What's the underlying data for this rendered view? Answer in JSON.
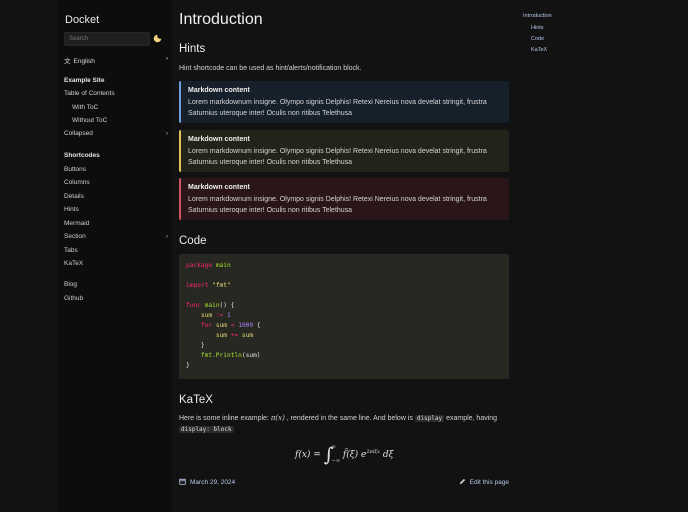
{
  "sidebar": {
    "title": "Docket",
    "search_placeholder": "Search",
    "language": "English",
    "items": [
      {
        "label": "Example Site",
        "bold": true
      },
      {
        "label": "Table of Contents"
      },
      {
        "label": "With ToC",
        "sub": true
      },
      {
        "label": "Without ToC",
        "sub": true
      },
      {
        "label": "Collapsed",
        "chevron": true
      },
      {
        "label": "Shortcodes",
        "bold": true
      },
      {
        "label": "Buttons"
      },
      {
        "label": "Columns"
      },
      {
        "label": "Details"
      },
      {
        "label": "Hints"
      },
      {
        "label": "Mermaid"
      },
      {
        "label": "Section",
        "chevron": true
      },
      {
        "label": "Tabs"
      },
      {
        "label": "KaTeX"
      },
      {
        "label": "Blog"
      },
      {
        "label": "Github"
      }
    ]
  },
  "main": {
    "title": "Introduction",
    "hints_heading": "Hints",
    "hints_intro": "Hint shortcode can be used as hint/alerts/notification block.",
    "hints": [
      {
        "title": "Markdown content",
        "body": "Lorem markdownum insigne. Olympo signis Delphis! Retexi Nereius nova develat stringit, frustra Saturnius uteroque inter! Oculis non ritibus Telethusa",
        "kind": "info"
      },
      {
        "title": "Markdown content",
        "body": "Lorem markdownum insigne. Olympo signis Delphis! Retexi Nereius nova develat stringit, frustra Saturnius uteroque inter! Oculis non ritibus Telethusa",
        "kind": "warn"
      },
      {
        "title": "Markdown content",
        "body": "Lorem markdownum insigne. Olympo signis Delphis! Retexi Nereius nova develat stringit, frustra Saturnius uteroque inter! Oculis non ritibus Telethusa",
        "kind": "danger"
      }
    ],
    "code_heading": "Code",
    "code": {
      "line1_kw": "package",
      "line1_nm": "main",
      "line2_kw": "import",
      "line2_st": "\"fmt\"",
      "line3_kw": "func",
      "line3_nm": "main",
      "line3_rest": "() {",
      "line4_var": "sum",
      "line4_op": ":=",
      "line4_num": "1",
      "line5_kw": "for",
      "line5_var": "sum",
      "line5_op": "<",
      "line5_num": "1000",
      "line5_rest": "{",
      "line6_var": "sum",
      "line6_op": "+=",
      "line6_var2": "sum",
      "line7": "}",
      "line8_nm": "fmt.Println",
      "line8_arg": "(sum)",
      "line9": "}"
    },
    "katex_heading": "KaTeX",
    "katex_text_1": "Here is some inline example:",
    "katex_inline": "π(x)",
    "katex_text_2": ", rendered in the same line. And below is",
    "katex_code_1": "display",
    "katex_text_3": "example, having",
    "katex_code_2": "display: block",
    "formula_lhs": "f(x) =",
    "formula_upper": "∞",
    "formula_lower": "−∞",
    "formula_body": "f̂(ξ) e",
    "formula_exp": "2πiξx",
    "formula_end": "dξ",
    "date": "March 29, 2024",
    "edit_label": "Edit this page"
  },
  "toc": {
    "items": [
      {
        "label": "Introduction"
      },
      {
        "label": "Hints",
        "sub": true
      },
      {
        "label": "Code",
        "sub": true
      },
      {
        "label": "KaTeX",
        "sub": true
      }
    ]
  },
  "colors": {
    "background": "#121212",
    "sidebar": "#0d0d0d",
    "link": "#b8c8ea",
    "hint_info": "#6f9be0",
    "hint_warn": "#e3c25a",
    "hint_danger": "#d05461"
  }
}
